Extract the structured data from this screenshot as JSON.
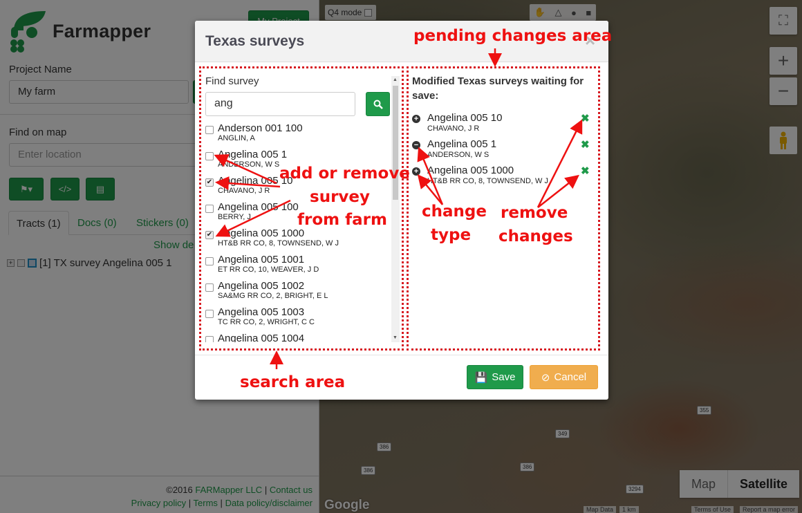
{
  "app": {
    "brand": "Farmapper",
    "my_project_label": "My Project",
    "project_name_label": "Project Name",
    "project_name_value": "My farm",
    "find_on_map_label": "Find on map",
    "find_on_map_placeholder": "Enter location",
    "tabs": [
      {
        "label": "Tracts (1)"
      },
      {
        "label": "Docs (0)"
      },
      {
        "label": "Stickers (0)"
      }
    ],
    "show_details_label": "Show de",
    "tract_row": "[1] TX survey Angelina 005 1",
    "footer": {
      "copyright": "©2016",
      "company": "FARMapper LLC",
      "contact": "Contact us",
      "privacy": "Privacy policy",
      "terms": "Terms",
      "data_policy": "Data policy/disclaimer",
      "sep": "|"
    }
  },
  "map": {
    "q4_mode_label": "Q4 mode",
    "map_type_map": "Map",
    "map_type_satellite": "Satellite",
    "google": "Google",
    "attributions": [
      "Map Data",
      "1 km",
      "Terms of Use",
      "Report a map error"
    ],
    "roads": [
      "355",
      "349",
      "3294",
      "386",
      "386",
      "386"
    ]
  },
  "modal": {
    "title": "Texas surveys",
    "find_label": "Find survey",
    "search_value": "ang",
    "results": [
      {
        "name": "Anderson 001 100",
        "owner": "ANGLIN, A",
        "checked": false
      },
      {
        "name": "Angelina 005 1",
        "owner": "ANDERSON, W S",
        "checked": false
      },
      {
        "name": "Angelina 005 10",
        "owner": "CHAVANO, J R",
        "checked": true
      },
      {
        "name": "Angelina 005 100",
        "owner": "BERRY, J",
        "checked": false
      },
      {
        "name": "Angelina 005 1000",
        "owner": "HT&B RR CO, 8, TOWNSEND, W J",
        "checked": true
      },
      {
        "name": "Angelina 005 1001",
        "owner": "ET RR CO, 10, WEAVER, J D",
        "checked": false
      },
      {
        "name": "Angelina 005 1002",
        "owner": "SA&MG RR CO, 2, BRIGHT, E L",
        "checked": false
      },
      {
        "name": "Angelina 005 1003",
        "owner": "TC RR CO, 2, WRIGHT, C C",
        "checked": false
      },
      {
        "name": "Angelina 005 1004",
        "owner": "",
        "checked": false
      }
    ],
    "pending_title": "Modified Texas surveys waiting for save:",
    "pending": [
      {
        "name": "Angelina 005 10",
        "owner": "CHAVANO, J R",
        "change": "add"
      },
      {
        "name": "Angelina 005 1",
        "owner": "ANDERSON, W S",
        "change": "remove"
      },
      {
        "name": "Angelina 005 1000",
        "owner": "HT&B RR CO, 8, TOWNSEND, W J",
        "change": "add"
      }
    ],
    "save_label": "Save",
    "cancel_label": "Cancel"
  },
  "annotations": {
    "pending_area": "pending changes area",
    "add_remove": [
      "add or remove",
      "survey",
      "from farm"
    ],
    "change_type": [
      "change",
      "type"
    ],
    "remove_changes": [
      "remove",
      "changes"
    ],
    "search_area": "search area"
  },
  "colors": {
    "brand_green": "#1f9a4a",
    "warning_orange": "#f0ad4e",
    "annotation_red": "#e11"
  }
}
